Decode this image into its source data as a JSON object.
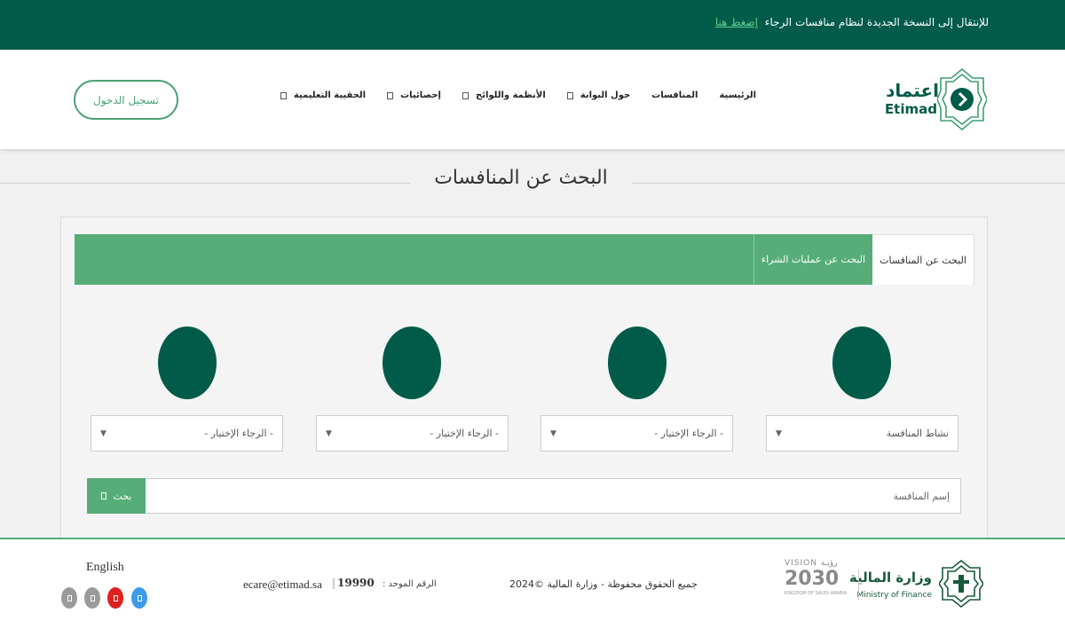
{
  "topbar": {
    "message": "للإنتقال إلى النسخة الجديدة لنظام منافسات الرجاء",
    "link": "إضغط هنا"
  },
  "header": {
    "logo_ar": "اعتماد",
    "logo_en": "Etimad",
    "login_label": "تسجيل الدخول",
    "nav": [
      {
        "label": "الرئيسية",
        "has_menu": false
      },
      {
        "label": "المنافسات",
        "has_menu": false
      },
      {
        "label": "حول البوابة",
        "has_menu": true
      },
      {
        "label": "الأنظمة واللوائح",
        "has_menu": true
      },
      {
        "label": "إحصائيات",
        "has_menu": true
      },
      {
        "label": "الحقيبة التعليمية",
        "has_menu": true
      }
    ]
  },
  "page": {
    "title": "البحث عن المنافسات"
  },
  "tabs": {
    "active": "البحث عن المنافسات",
    "other": "البحث عن عمليات الشراء"
  },
  "filters": {
    "selects": [
      {
        "value": "نشاط المنافسة"
      },
      {
        "value": "- الرجاء الإختيار -"
      },
      {
        "value": "- الرجاء الإختيار -"
      },
      {
        "value": "- الرجاء الإختيار -"
      }
    ],
    "arrow": "▼"
  },
  "search": {
    "placeholder": "إسم المنافسة",
    "button_label": "بحث"
  },
  "footer": {
    "ministry_ar": "وزارة المالية",
    "ministry_en": "Ministry of Finance",
    "vision_top": "VISION رؤيـة",
    "vision_year": "2030",
    "vision_sub": "KINGDOM OF SAUDI ARABIA",
    "copyright": "جميع الحقوق محفوظة - وزارة المالية ©2024",
    "unified_label": "الرقم الموحد :",
    "unified_number": "19990",
    "separator": "|",
    "email": "ecare@etimad.sa",
    "language": "English"
  },
  "colors": {
    "primary_dark": "#005b49",
    "primary_green": "#56ad77",
    "social": [
      "#9a9a9a",
      "#9a9a9a",
      "#e02020",
      "#3d9be9"
    ]
  }
}
